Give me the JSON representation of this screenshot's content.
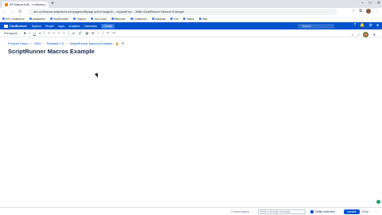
{
  "browser": {
    "tab_title": "SR Macros Edit – Confluence",
    "new_tab": "+",
    "url": "dev-confluence.adaptavist.com/pages/editpage.action?pageId=…&spaceKey=…&title=ScriptRunner+Macros+Example",
    "bookmarks": [
      "iOS Confluence",
      "Adaptavist",
      "ScriptRunner",
      "Support",
      "Jira Cloud",
      "Bitbucket",
      "Confluence",
      "Atlassian",
      "Dev",
      "Status",
      "Wiki"
    ]
  },
  "confluence": {
    "logo": "Confluence",
    "menus": [
      "Spaces",
      "People",
      "Apps",
      "Analytics",
      "Calendars"
    ],
    "create": "Create",
    "search_placeholder": "Search"
  },
  "editor": {
    "paragraph_style": "Paragraph",
    "toolbar": [
      "B",
      "I",
      "U",
      "A",
      "≡",
      "≡",
      "≡",
      "≡",
      "☑",
      "🔗",
      "▦",
      "⊞",
      "+",
      "↶",
      "↷"
    ],
    "right_tools": [
      "⌕",
      "?",
      "⚙"
    ]
  },
  "breadcrumbs": {
    "items": [
      "Product Demo",
      "2020",
      "Release 1.0",
      "ScriptRunner Macros Example"
    ]
  },
  "page": {
    "title": "ScriptRunner Macros Example"
  },
  "footer": {
    "content_status": "Content status",
    "comment_placeholder": "Write a change message",
    "notify_label": "Notify watchers",
    "update": "Update",
    "close": "Close",
    "more": "···"
  }
}
